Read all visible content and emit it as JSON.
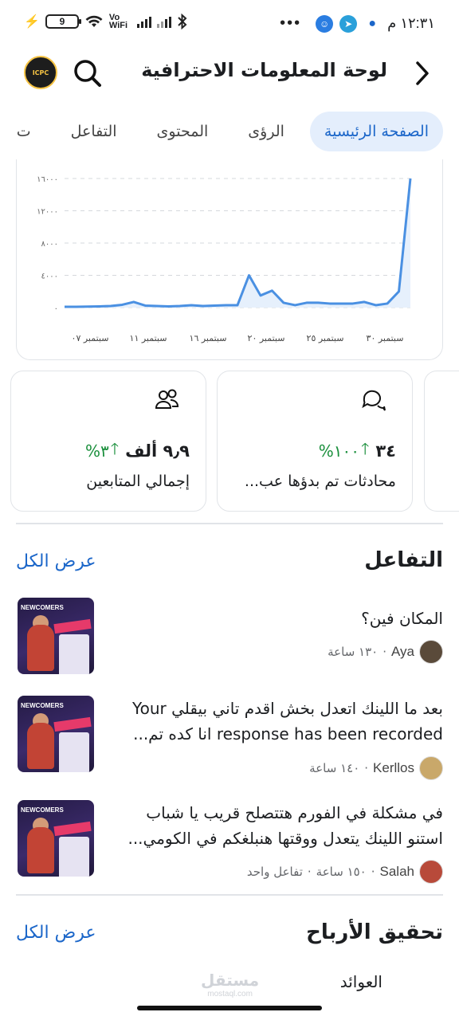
{
  "status_bar": {
    "time": "١٢:٣١ م",
    "battery": "9",
    "network": "Vo WiFi",
    "more": "•••"
  },
  "header": {
    "title": "لوحة المعلومات الاحترافية",
    "avatar_text": "ICPC"
  },
  "tabs": [
    {
      "label": "الصفحة الرئيسية",
      "active": true
    },
    {
      "label": "الرؤى",
      "active": false
    },
    {
      "label": "المحتوى",
      "active": false
    },
    {
      "label": "التفاعل",
      "active": false
    },
    {
      "label": "ت",
      "active": false
    }
  ],
  "chart_data": {
    "type": "area",
    "y_ticks": [
      "١٦٠٠٠",
      "١٢٠٠٠",
      "٨٠٠٠",
      "٤٠٠٠",
      "٠"
    ],
    "ylim": [
      0,
      16000
    ],
    "x_ticks": [
      "سبتمبر ٠٧",
      "سبتمبر ١١",
      "سبتمبر ١٦",
      "سبتمبر ٢٠",
      "سبتمبر ٢٥",
      "سبتمبر ٣٠"
    ],
    "x": [
      "09-04",
      "09-05",
      "09-06",
      "09-07",
      "09-08",
      "09-09",
      "09-10",
      "09-11",
      "09-12",
      "09-13",
      "09-14",
      "09-15",
      "09-16",
      "09-17",
      "09-18",
      "09-19",
      "09-20",
      "09-21",
      "09-22",
      "09-23",
      "09-24",
      "09-25",
      "09-26",
      "09-27",
      "09-28",
      "09-29",
      "09-30",
      "10-01",
      "10-02",
      "10-03",
      "10-04"
    ],
    "values": [
      100,
      100,
      120,
      150,
      200,
      350,
      700,
      250,
      200,
      150,
      200,
      300,
      200,
      250,
      300,
      300,
      4000,
      1500,
      2100,
      600,
      300,
      600,
      600,
      500,
      500,
      500,
      700,
      300,
      500,
      2000,
      16000
    ],
    "color": "#4a90e2",
    "fill": "#e6f0fc",
    "grid": true
  },
  "stats": [
    {
      "value": "٩٫٩ ألف",
      "change": "٣%",
      "label": "إجمالي المتابعين",
      "icon": "people-icon"
    },
    {
      "value": "٣٤",
      "change": "١٠٠%",
      "label": "محادثات تم بدؤها عب...",
      "icon": "chat-icon"
    }
  ],
  "interaction": {
    "title": "التفاعل",
    "see_all": "عرض الكل",
    "items": [
      {
        "text": "المكان فين؟",
        "author": "Aya",
        "time": "١٣٠ ساعة",
        "extra": ""
      },
      {
        "text": "بعد ما اللينك اتعدل بخش اقدم تاني بيقلي Your response has been recorded انا كده تم...",
        "author": "Kerllos",
        "time": "١٤٠ ساعة",
        "extra": ""
      },
      {
        "text": "في مشكلة في الفورم هتتصلح قريب يا شباب استنو اللينك يتعدل ووقتها هنبلغكم في الكومي...",
        "author": "Salah",
        "time": "١٥٠ ساعة",
        "extra": "تفاعل واحد"
      }
    ],
    "thumb_text": "NEWCOMERS"
  },
  "monetization": {
    "title": "تحقيق الأرباح",
    "see_all": "عرض الكل",
    "first_row": "العوائد"
  },
  "watermark": {
    "text": "مستقل",
    "sub": "mostaql.com"
  },
  "colors": {
    "accent": "#1b66c9",
    "positive": "#1a8f3c",
    "tab_active_bg": "#e4eefc"
  }
}
